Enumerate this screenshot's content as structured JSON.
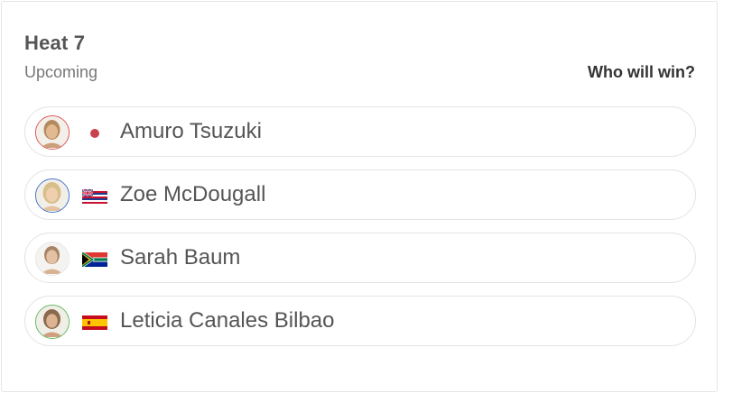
{
  "heat": {
    "title": "Heat 7",
    "status": "Upcoming",
    "prompt": "Who will win?"
  },
  "surfers": [
    {
      "name": "Amuro Tsuzuki",
      "flag_icon": "japan-flag-icon",
      "ring_color": "#d9534f"
    },
    {
      "name": "Zoe McDougall",
      "flag_icon": "hawaii-flag-icon",
      "ring_color": "#3c6fc4"
    },
    {
      "name": "Sarah Baum",
      "flag_icon": "south-africa-flag-icon",
      "ring_color": "#cfcfcf"
    },
    {
      "name": "Leticia Canales Bilbao",
      "flag_icon": "spain-flag-icon",
      "ring_color": "#5cb85c"
    }
  ]
}
